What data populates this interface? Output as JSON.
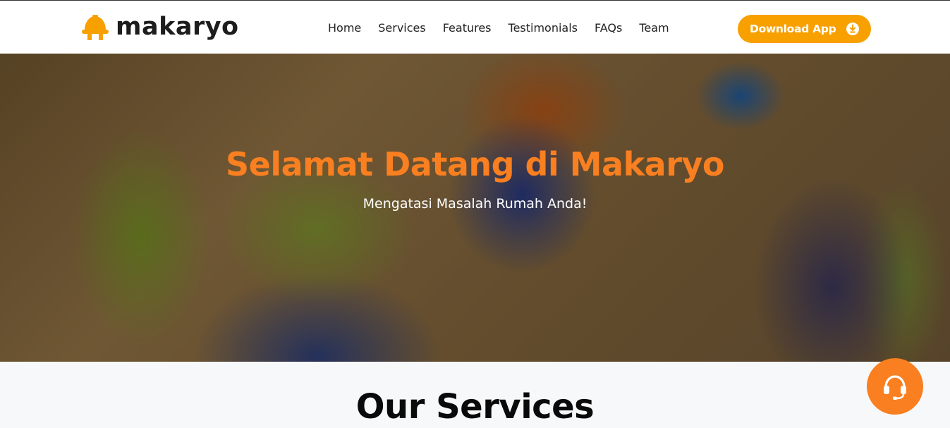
{
  "brand": {
    "name": "makaryo",
    "logo_icon": "hard-hat-icon",
    "accent_color": "#f7a000"
  },
  "nav": {
    "items": [
      {
        "label": "Home"
      },
      {
        "label": "Services"
      },
      {
        "label": "Features"
      },
      {
        "label": "Testimonials"
      },
      {
        "label": "FAQs"
      },
      {
        "label": "Team"
      }
    ],
    "download_label": "Download App",
    "download_icon": "download-circle-icon"
  },
  "hero": {
    "title": "Selamat Datang di Makaryo",
    "subtitle": "Mengatasi Masalah Rumah Anda!",
    "title_color": "#f97f20"
  },
  "services": {
    "title": "Our Services"
  },
  "support": {
    "icon": "headset-support-icon",
    "color": "#f97f20"
  }
}
